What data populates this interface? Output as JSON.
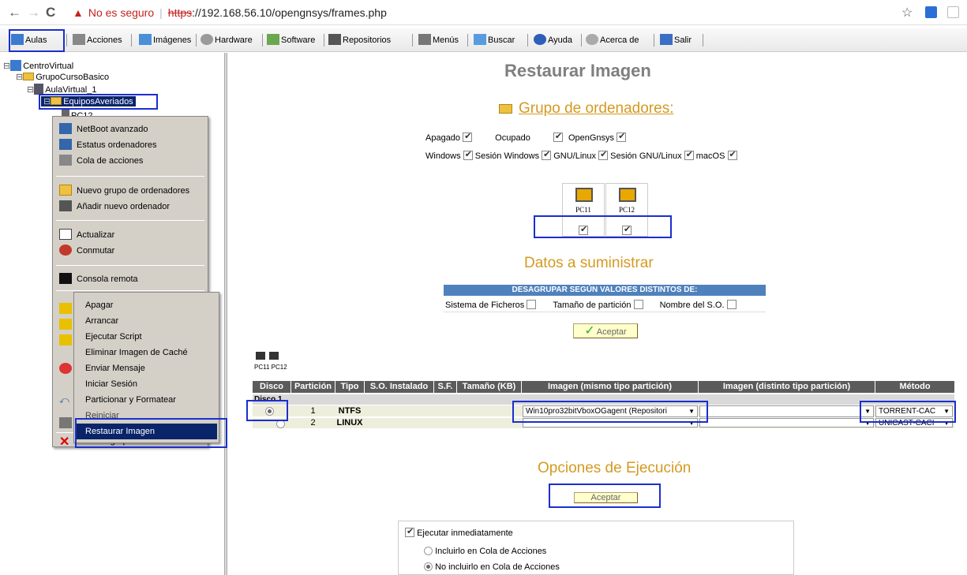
{
  "browser": {
    "security_label": "No es seguro",
    "scheme": "https",
    "url_rest": "://192.168.56.10/opengnsys/frames.php",
    "back_label": "←",
    "forward_label": "→",
    "reload_label": "C",
    "warn_glyph": "▲",
    "star": "☆"
  },
  "toolbar": {
    "items": [
      "Aulas",
      "Acciones",
      "Imágenes",
      "Hardware",
      "Software",
      "Repositorios",
      "Menús",
      "Buscar",
      "Ayuda",
      "Acerca de",
      "Salir"
    ]
  },
  "tree": {
    "root": "CentroVirtual",
    "group": "GrupoCursoBasico",
    "aula": "AulaVirtual_1",
    "selected": "EquiposAveriados",
    "pc": "PC12"
  },
  "context_menu": {
    "items": [
      "NetBoot avanzado",
      "Estatus ordenadores",
      "Cola de acciones",
      "Nuevo grupo de ordenadores",
      "Añadir nuevo ordenador",
      "Actualizar",
      "Conmutar",
      "Consola remota"
    ],
    "last": "Eliminar grupo de ordenadores"
  },
  "submenu": {
    "items": [
      "Apagar",
      "Arrancar",
      "Ejecutar Script",
      "Eliminar Imagen de Caché",
      "Enviar Mensaje",
      "Iniciar Sesión",
      "Particionar y Formatear",
      "Reiniciar",
      "Restaurar Imagen"
    ]
  },
  "main": {
    "title": "Restaurar Imagen",
    "group_title": "Grupo de ordenadores:",
    "filters_row1": [
      "Apagado",
      "Ocupado",
      "OpenGnsys"
    ],
    "filters_row2": [
      "Windows",
      "Sesión Windows",
      "GNU/Linux",
      "Sesión GNU/Linux",
      "macOS"
    ],
    "pcs": [
      "PC11",
      "PC12"
    ],
    "datos_title": "Datos a suministrar",
    "desagrupar_header": "DESAGRUPAR SEGÚN VALORES DISTINTOS DE:",
    "desagrupar_opts": [
      "Sistema de Ficheros",
      "Tamaño de partición",
      "Nombre del S.O."
    ],
    "accept_label": "Aceptar",
    "accept_check": "✓",
    "pcs_small": "PC11 PC12",
    "table_headers": [
      "Disco",
      "Partición",
      "Tipo",
      "S.O. Instalado",
      "S.F.",
      "Tamaño (KB)",
      "Imagen (mismo tipo partición)",
      "Imagen (distinto tipo partición)",
      "Método"
    ],
    "disk_label": "Disco 1",
    "rows": [
      {
        "particion": "1",
        "tipo": "NTFS",
        "imagen": "Win10pro32bitVboxOGagent (Repositori",
        "metodo": "TORRENT-CAC"
      },
      {
        "particion": "2",
        "tipo": "LINUX",
        "imagen": "",
        "metodo": "UNICAST-CACI"
      }
    ],
    "opciones_title": "Opciones de Ejecución",
    "opciones_accept": "Aceptar",
    "ejecutar": "Ejecutar inmediatamente",
    "incluirlo": "Incluirlo en Cola de Acciones",
    "no_incluirlo": "No incluirlo en Cola de Acciones"
  },
  "colors": {
    "highlight": "#1a2fd0",
    "orange": "#d49a22",
    "title_gray": "#7f7f7f",
    "menu_selected": "#0a246a"
  }
}
